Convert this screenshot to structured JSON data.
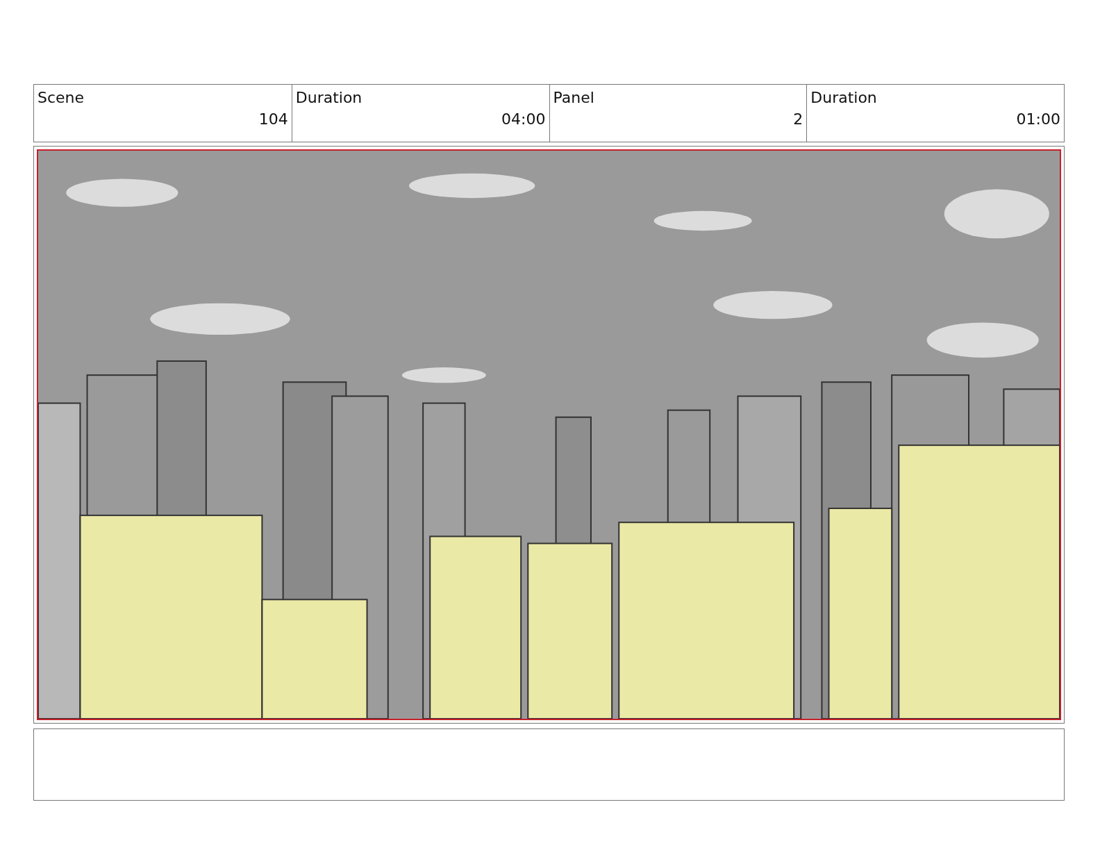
{
  "header": {
    "labels": [
      "Scene",
      "Duration",
      "Panel",
      "Duration"
    ],
    "values": [
      "104",
      "04:00",
      "2",
      "01:00"
    ]
  }
}
